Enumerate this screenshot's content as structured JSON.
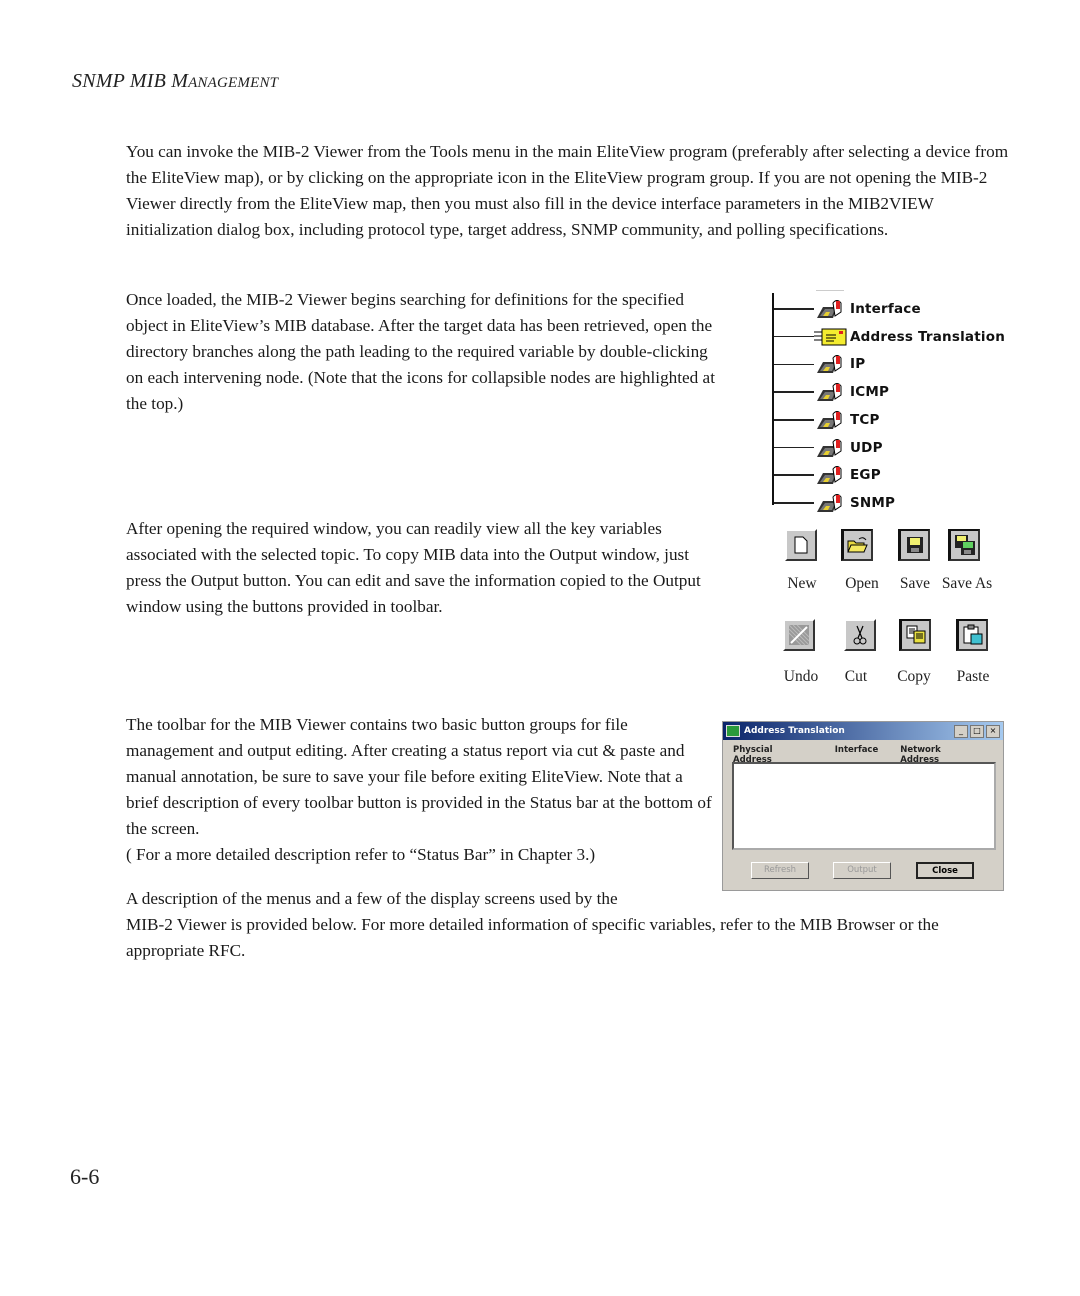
{
  "header": {
    "title_caps": [
      "SNMP MIB M",
      "ANAGEMENT"
    ]
  },
  "paragraphs": {
    "p1": "You can invoke the MIB-2 Viewer from the Tools menu in the main EliteView program (preferably after selecting a device from the EliteView map), or by clicking on the appropriate icon in the EliteView program group. If you are not opening the MIB-2 Viewer directly from the EliteView map, then you must also fill in the device interface parameters in the MIB2VIEW initialization dialog box, including protocol type, target address, SNMP community, and polling specifications.",
    "p2": "Once loaded, the MIB-2 Viewer begins searching for definitions for the specified object in EliteView’s MIB database. After the target data has been retrieved, open the directory branches along the path leading to the required variable by double-clicking on each intervening node. (Note that the icons for collapsible nodes are highlighted at the top.)",
    "p3": "After opening the required window, you can readily view all the key variables associated with the selected topic. To copy MIB data into the Output window, just press the Output button. You can edit and save the information copied to the Output window using the buttons provided in toolbar.",
    "p4": "The toolbar for the MIB Viewer contains two basic button groups for file management and output editing. After creating a status report via cut & paste and manual annotation, be sure to save your file before exiting EliteView. Note that a brief description of every toolbar button is provided in the Status bar at the bottom of the screen.",
    "p4b": "( For a more detailed description refer to  “Status Bar” in Chapter 3.)",
    "p5_line1": "A description of the menus and a few of the display screens used by the",
    "p5_rest": "MIB-2 Viewer is provided below. For more detailed information of specific variables, refer to the MIB Browser or the appropriate RFC."
  },
  "tree": {
    "nodes": [
      {
        "label": "Interface",
        "icon": "mib-folder-icon"
      },
      {
        "label": "Address Translation",
        "icon": "open-envelope-icon"
      },
      {
        "label": "IP",
        "icon": "mib-folder-icon"
      },
      {
        "label": "ICMP",
        "icon": "mib-folder-icon"
      },
      {
        "label": "TCP",
        "icon": "mib-folder-icon"
      },
      {
        "label": "UDP",
        "icon": "mib-folder-icon"
      },
      {
        "label": "EGP",
        "icon": "mib-folder-icon"
      },
      {
        "label": "SNMP",
        "icon": "mib-folder-icon"
      }
    ]
  },
  "toolbar_file": [
    {
      "label": "New",
      "icon": "new-file-icon"
    },
    {
      "label": "Open",
      "icon": "open-folder-icon"
    },
    {
      "label": "Save",
      "icon": "save-disk-icon"
    },
    {
      "label": "Save As",
      "icon": "save-as-icon"
    }
  ],
  "toolbar_edit": [
    {
      "label": "Undo",
      "icon": "undo-icon"
    },
    {
      "label": "Cut",
      "icon": "scissors-icon"
    },
    {
      "label": "Copy",
      "icon": "copy-icon"
    },
    {
      "label": "Paste",
      "icon": "paste-icon"
    }
  ],
  "dialog": {
    "title": "Address Translation",
    "columns": [
      "Physcial Address",
      "Interface",
      "Network Address"
    ],
    "buttons": {
      "refresh": "Refresh",
      "output": "Output",
      "close": "Close"
    },
    "window_buttons": {
      "minimize": "_",
      "maximize": "□",
      "close": "×"
    }
  },
  "page_number": "6-6"
}
